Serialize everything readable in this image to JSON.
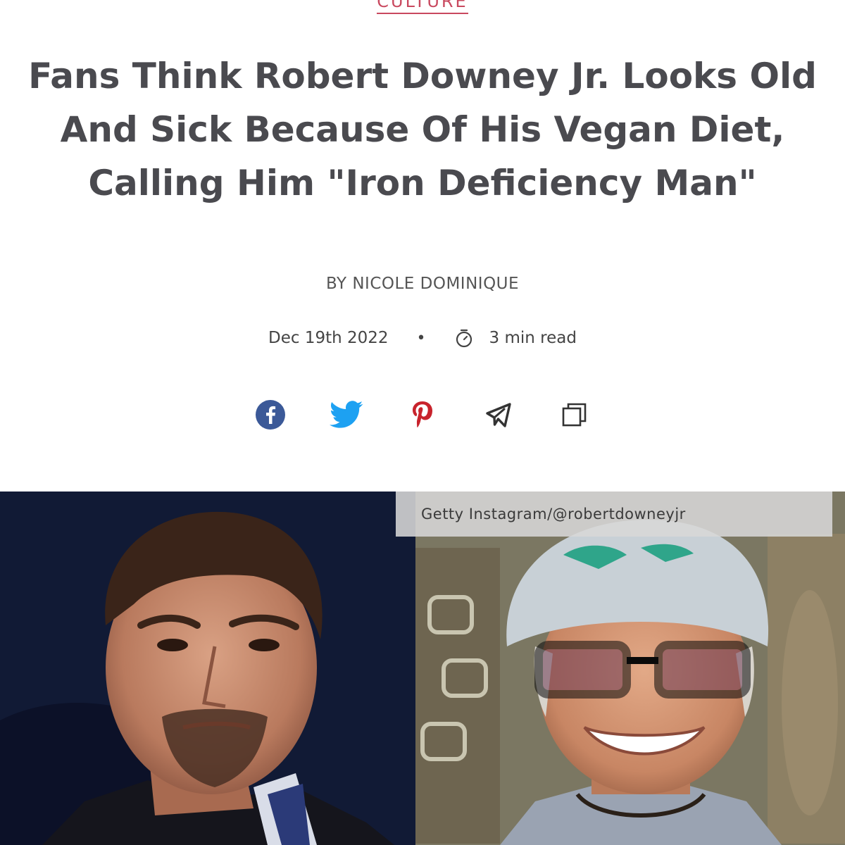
{
  "article": {
    "category": "CULTURE",
    "headline": "Fans Think Robert Downey Jr. Looks Old And Sick Because Of His Vegan Diet, Calling Him \"Iron Deficiency Man\"",
    "byline": "BY NICOLE DOMINIQUE",
    "date": "Dec 19th 2022",
    "separator": "•",
    "read_time": "3 min read"
  },
  "share": {
    "icons": [
      "facebook-icon",
      "twitter-icon",
      "pinterest-icon",
      "telegram-icon",
      "copy-link-icon"
    ],
    "colors": {
      "facebook": "#3b5998",
      "twitter": "#1da1f2",
      "pinterest": "#c8232c",
      "telegram": "#333333",
      "copy": "#333333"
    }
  },
  "image": {
    "caption": "Getty Instagram/@robertdowneyjr"
  },
  "colors": {
    "accent": "#c9495f",
    "headline": "#4a4a4f"
  }
}
